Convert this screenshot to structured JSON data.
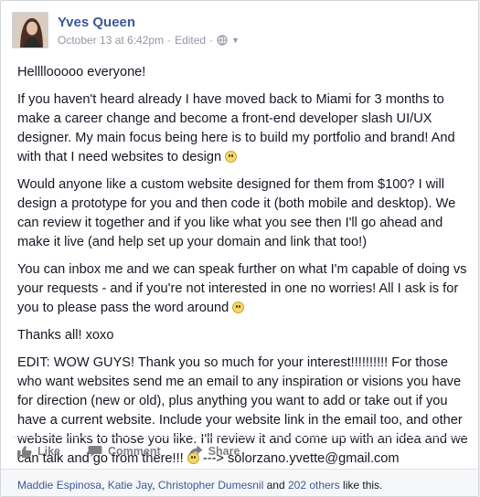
{
  "post": {
    "author": "Yves Queen",
    "timestamp": "October 13 at 6:42pm",
    "edited": "Edited",
    "separator": "·",
    "privacy_icon": "globe-icon",
    "menu_icon": "chevron-down-icon",
    "paragraphs": [
      "Hellllooooo everyone!",
      "If you haven't heard already I have moved back to Miami for 3 months to make a career change and become a front-end developer slash UI/UX designer. My main focus being here is to build my portfolio and brand! And with that I need websites to design",
      "Would anyone like a custom website designed for them from $100? I will design a prototype for you and then code it (both mobile and desktop). We can review it together and if you like what you see then I'll go ahead and make it live (and help set up your domain and link that too!)",
      "You can inbox me and we can speak further on what I'm capable of doing vs your requests - and if you're not interested in one no worries! All I ask is for you to please pass the word around",
      "Thanks all! xoxo",
      "EDIT: WOW GUYS! Thank you so much for your interest!!!!!!!!!! For those who want websites send me an email to any inspiration or visions you have for direction (new or old), plus anything you want to add or take out if you have a current website. Include your website link in the email too, and other website links to those you like. I'll review it and come up with an idea and we can talk and go from there!!!"
    ],
    "edit_tail": "---> solorzano.yvette@gmail.com"
  },
  "actions": {
    "like_label": "Like",
    "comment_label": "Comment",
    "share_label": "Share"
  },
  "likes": {
    "names": [
      "Maddie Espinosa",
      "Katie Jay",
      "Christopher Dumesnil"
    ],
    "sep1": ", ",
    "sep2": ", ",
    "and": " and ",
    "others": "202 others",
    "suffix": " like this."
  }
}
